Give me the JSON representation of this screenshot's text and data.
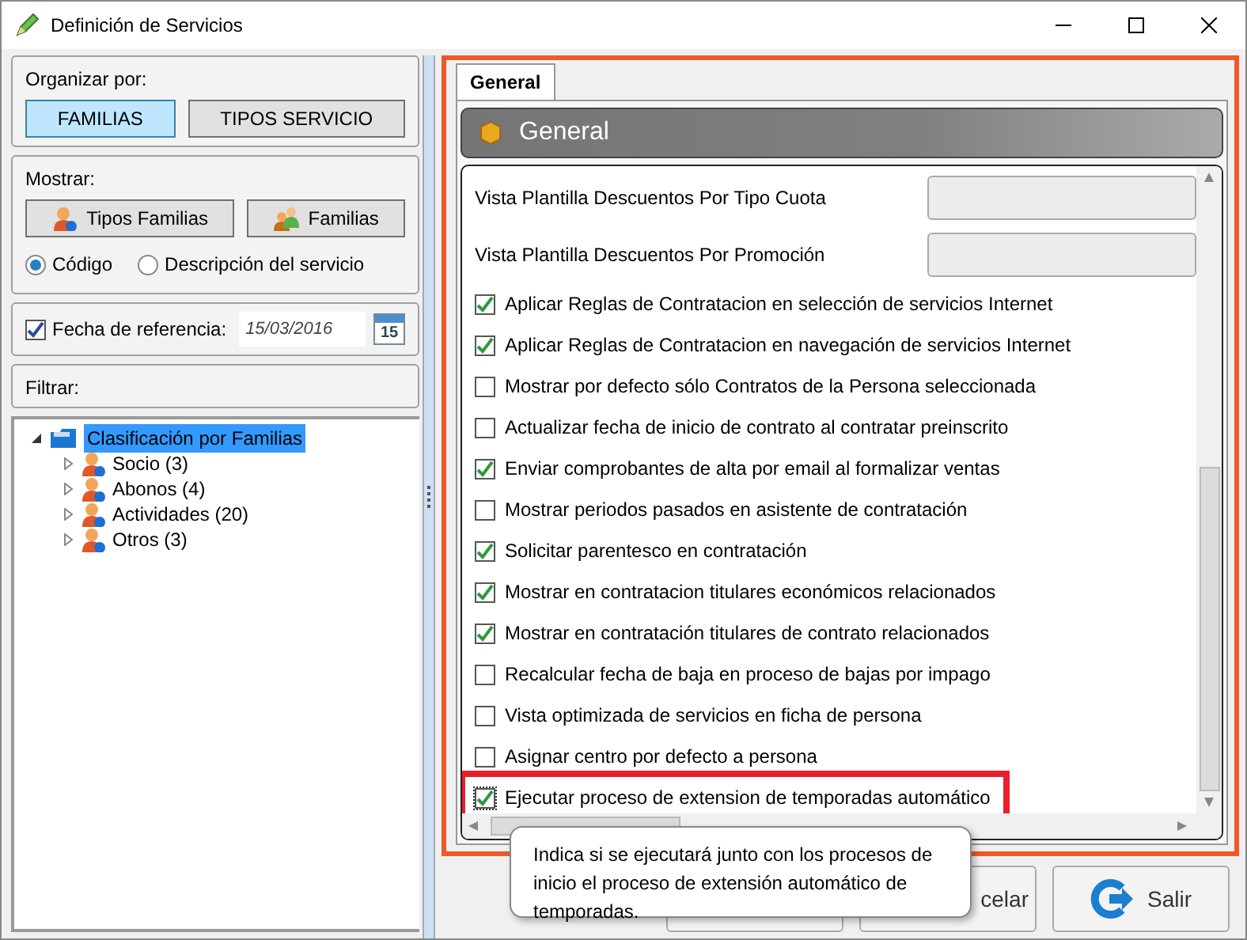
{
  "window": {
    "title": "Definición de Servicios"
  },
  "organize": {
    "label": "Organizar por:",
    "buttons": [
      {
        "label": "FAMILIAS",
        "selected": true
      },
      {
        "label": "TIPOS SERVICIO",
        "selected": false
      }
    ]
  },
  "show": {
    "label": "Mostrar:",
    "buttons": [
      "Tipos Familias",
      "Familias"
    ],
    "radios": [
      {
        "label": "Código",
        "selected": true
      },
      {
        "label": "Descripción del servicio",
        "selected": false
      }
    ]
  },
  "reference_date": {
    "label": "Fecha de referencia:",
    "checked": true,
    "value": "15/03/2016",
    "calendar_day": "15"
  },
  "filter": {
    "label": "Filtrar:"
  },
  "tree": {
    "label": "Clasificación por Familias",
    "expanded": true,
    "selected": true,
    "children": [
      {
        "label": "Socio (3)",
        "expanded": false
      },
      {
        "label": "Abonos (4)",
        "expanded": false
      },
      {
        "label": "Actividades (20)",
        "expanded": false
      },
      {
        "label": "Otros (3)",
        "expanded": false
      }
    ]
  },
  "tabs": [
    {
      "label": "General",
      "selected": true
    }
  ],
  "section": {
    "title": "General"
  },
  "settings": [
    {
      "kind": "field",
      "label": "Vista Plantilla Descuentos Por Tipo Cuota"
    },
    {
      "kind": "field",
      "label": "Vista Plantilla Descuentos Por Promoción"
    },
    {
      "kind": "check",
      "label": "Aplicar Reglas de Contratacion en selección de servicios Internet",
      "checked": true
    },
    {
      "kind": "check",
      "label": "Aplicar Reglas de Contratacion en navegación de servicios Internet",
      "checked": true
    },
    {
      "kind": "check",
      "label": "Mostrar por defecto sólo Contratos de la Persona seleccionada",
      "checked": false
    },
    {
      "kind": "check",
      "label": "Actualizar fecha de inicio de contrato al contratar preinscrito",
      "checked": false
    },
    {
      "kind": "check",
      "label": "Enviar comprobantes de alta por email al formalizar ventas",
      "checked": true
    },
    {
      "kind": "check",
      "label": "Mostrar periodos pasados en asistente de contratación",
      "checked": false
    },
    {
      "kind": "check",
      "label": "Solicitar parentesco en contratación",
      "checked": true
    },
    {
      "kind": "check",
      "label": "Mostrar en contratacion titulares económicos relacionados",
      "checked": true
    },
    {
      "kind": "check",
      "label": "Mostrar en contratación titulares de contrato relacionados",
      "checked": true
    },
    {
      "kind": "check",
      "label": "Recalcular fecha de baja en proceso de bajas por impago",
      "checked": false
    },
    {
      "kind": "check",
      "label": "Vista optimizada de servicios en ficha de persona",
      "checked": false
    },
    {
      "kind": "check",
      "label": "Asignar centro por defecto a persona",
      "checked": false
    },
    {
      "kind": "check",
      "label": "Ejecutar proceso de extension de temporadas automático",
      "checked": true,
      "highlighted": true
    }
  ],
  "tooltip": "Indica si se ejecutará junto con los procesos de inicio el proceso de extensión automático de temporadas.",
  "footer_buttons": [
    {
      "kind": "validate"
    },
    {
      "kind": "cancel",
      "label": "celar"
    },
    {
      "kind": "exit",
      "label": "Salir"
    }
  ]
}
